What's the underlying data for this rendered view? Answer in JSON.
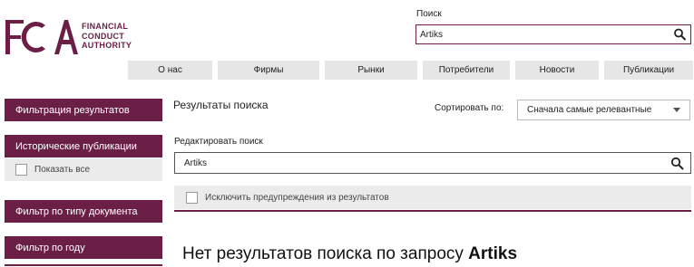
{
  "logo": {
    "letters": "FCA",
    "lines": [
      "FINANCIAL",
      "CONDUCT",
      "AUTHORITY"
    ],
    "color": "#6b1f46"
  },
  "header_search": {
    "label": "Поиск",
    "value": "Artiks",
    "icon": "search-icon"
  },
  "nav": {
    "items": [
      "О нас",
      "Фирмы",
      "Рынки",
      "Потребители",
      "Новости",
      "Публикации"
    ]
  },
  "sidebar": {
    "filter_results": "Фильтрация результатов",
    "historical": "Исторические публикации",
    "show_all": "Показать все",
    "doc_type": "Фильтр по типу документа",
    "by_year": "Фильтр по году"
  },
  "main": {
    "results_title": "Результаты поиска",
    "sort_label": "Сортировать по:",
    "sort_value": "Сначала самые релевантные",
    "edit_label": "Редактировать поиск",
    "edit_value": "Artiks",
    "exclude_label": "Исключить предупреждения из результатов",
    "no_results_prefix": "Нет результатов поиска по запросу",
    "no_results_query": "Artiks"
  },
  "colors": {
    "brand": "#6b1f46",
    "nav_bg": "#e7e6e6",
    "panel_bg": "#ecebeb"
  }
}
